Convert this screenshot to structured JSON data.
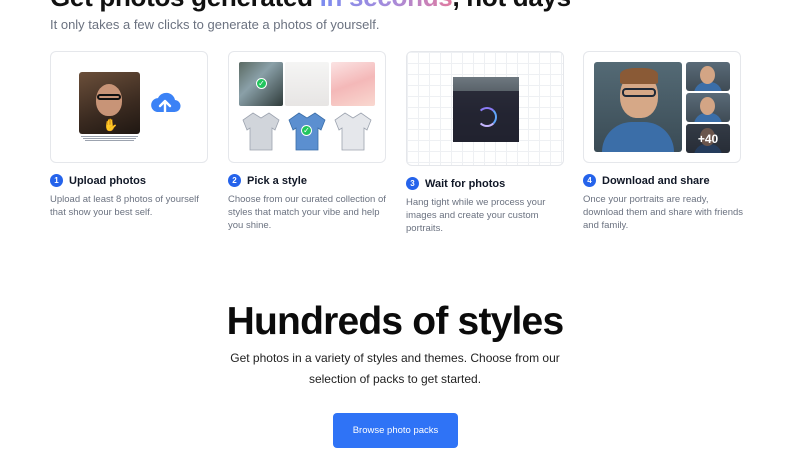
{
  "hero": {
    "headline_part1": "Get photos generated ",
    "headline_highlight": "in seconds",
    "headline_part2": ", not days",
    "subheading": "It only takes a few clicks to generate a photos of yourself."
  },
  "steps": [
    {
      "number": "1",
      "title": "Upload photos",
      "description": "Upload at least 8 photos of yourself that show your best self."
    },
    {
      "number": "2",
      "title": "Pick a style",
      "description": "Choose from our curated collection of styles that match your vibe and help you shine."
    },
    {
      "number": "3",
      "title": "Wait for photos",
      "description": "Hang tight while we process your images and create your custom portraits."
    },
    {
      "number": "4",
      "title": "Download and share",
      "description": "Once your portraits are ready, download them and share with friends and family."
    }
  ],
  "download_card": {
    "more_count": "+40"
  },
  "styles_section": {
    "title": "Hundreds of styles",
    "description": "Get photos in a variety of styles and themes. Choose from our selection of packs to get started.",
    "cta_label": "Browse photo packs"
  },
  "colors": {
    "accent": "#2f73f6",
    "step_number": "#2563eb",
    "check": "#22c55e",
    "muted_text": "#6b7280"
  },
  "icons": [
    "upload-cloud-icon",
    "check-icon",
    "loading-spinner-icon",
    "hand-cursor-icon"
  ]
}
